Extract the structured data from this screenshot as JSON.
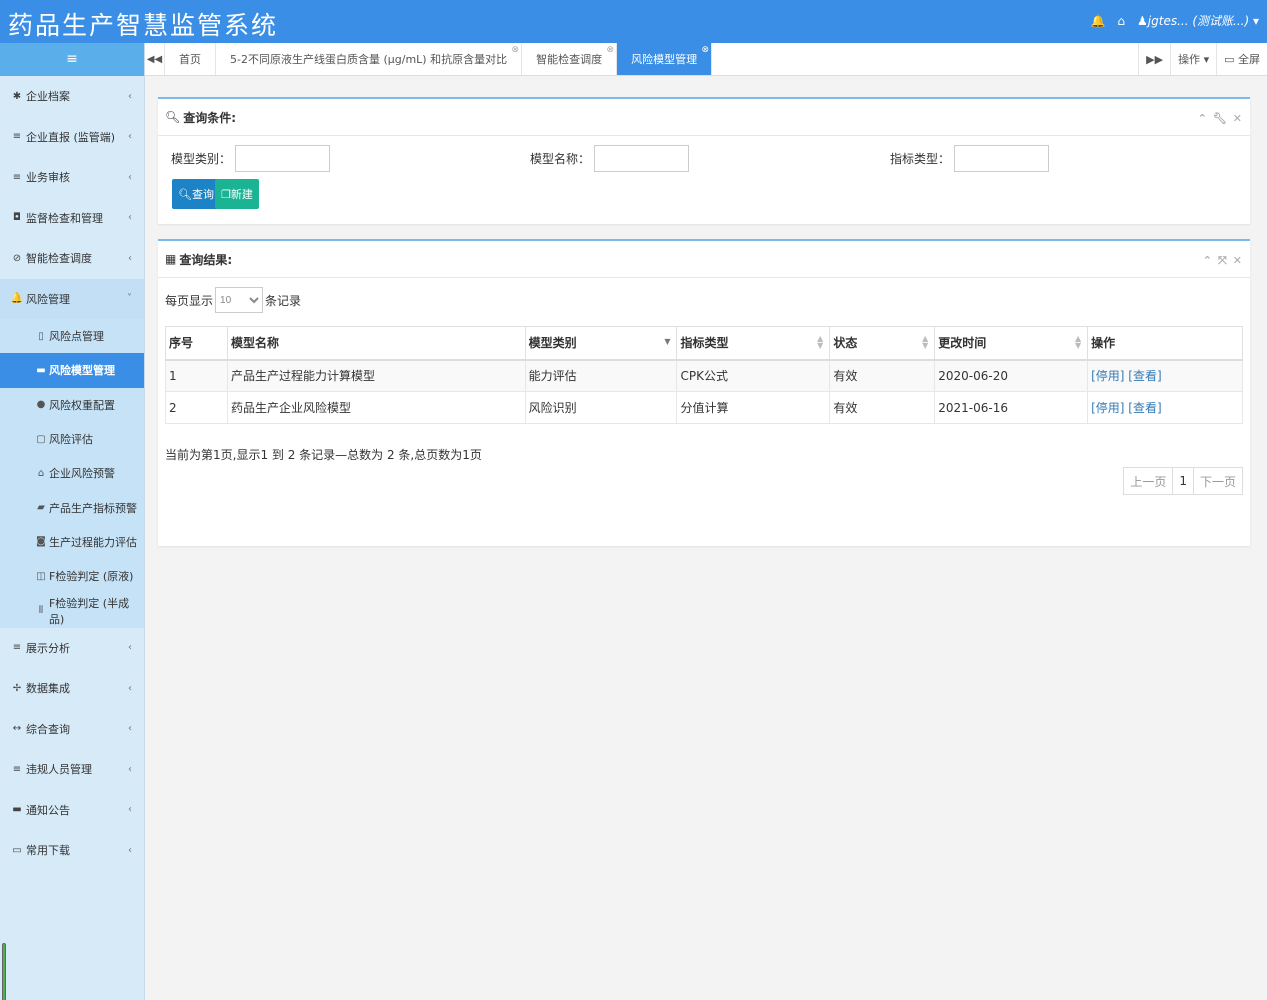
{
  "app": {
    "title": "药品生产智慧监管系统",
    "user": "jgtes... (测试账...)"
  },
  "sidebar": {
    "toggle_icon": "≡",
    "items_top": [
      {
        "label": "企业档案",
        "icon": "✱"
      },
      {
        "label": "企业直报 (监管端)",
        "icon": "≡"
      },
      {
        "label": "业务审核",
        "icon": "≡"
      },
      {
        "label": "监督检查和管理",
        "icon": "◘"
      },
      {
        "label": "智能检查调度",
        "icon": "⊘"
      }
    ],
    "open_item": {
      "label": "风险管理",
      "icon": "🔔"
    },
    "subitems": [
      {
        "label": "风险点管理",
        "icon": "▯"
      },
      {
        "label": "风险模型管理",
        "icon": "▬"
      },
      {
        "label": "风险权重配置",
        "icon": "●"
      },
      {
        "label": "风险评估",
        "icon": "▢"
      },
      {
        "label": "企业风险预警",
        "icon": "⌂"
      },
      {
        "label": "产品生产指标预警",
        "icon": "▰"
      },
      {
        "label": "生产过程能力评估",
        "icon": "◙"
      },
      {
        "label": "F检验判定 (原液)",
        "icon": "◫"
      },
      {
        "label": "F检验判定 (半成品)",
        "icon": "⦀"
      }
    ],
    "items_bottom": [
      {
        "label": "展示分析",
        "icon": "≡"
      },
      {
        "label": "数据集成",
        "icon": "✢"
      },
      {
        "label": "综合查询",
        "icon": "↔"
      },
      {
        "label": "违规人员管理",
        "icon": "≡"
      },
      {
        "label": "通知公告",
        "icon": "▬"
      },
      {
        "label": "常用下载",
        "icon": "▭"
      }
    ]
  },
  "tabs": [
    {
      "label": "首页"
    },
    {
      "label": "5-2不同原液生产线蛋白质含量 (μg/mL) 和抗原含量对比"
    },
    {
      "label": "智能检查调度"
    },
    {
      "label": "风险模型管理"
    }
  ],
  "tabbar_right": {
    "ops": "操作",
    "fullscreen": "全屏"
  },
  "query_panel": {
    "title": "查询条件:",
    "fields": [
      {
        "label": "模型类别：",
        "value": ""
      },
      {
        "label": "模型名称：",
        "value": ""
      },
      {
        "label": "指标类型：",
        "value": ""
      }
    ],
    "search_label": "查询",
    "new_label": "新建"
  },
  "result_panel": {
    "title": "查询结果:",
    "page_size_prefix": "每页显示",
    "page_size_value": "10",
    "page_size_suffix": "条记录",
    "columns": [
      "序号",
      "模型名称",
      "模型类别",
      "指标类型",
      "状态",
      "更改时间",
      "操作"
    ],
    "rows": [
      {
        "no": "1",
        "name": "产品生产过程能力计算模型",
        "category": "能力评估",
        "indicator": "CPK公式",
        "status": "有效",
        "time": "2020-06-20",
        "op_disable": "[停用]",
        "op_view": "[查看]"
      },
      {
        "no": "2",
        "name": "药品生产企业风险模型",
        "category": "风险识别",
        "indicator": "分值计算",
        "status": "有效",
        "time": "2021-06-16",
        "op_disable": "[停用]",
        "op_view": "[查看]"
      }
    ],
    "page_info": "当前为第1页,显示1 到 2 条记录—总数为 2 条,总页数为1页",
    "pager": {
      "prev": "上一页",
      "current": "1",
      "next": "下一页"
    }
  }
}
